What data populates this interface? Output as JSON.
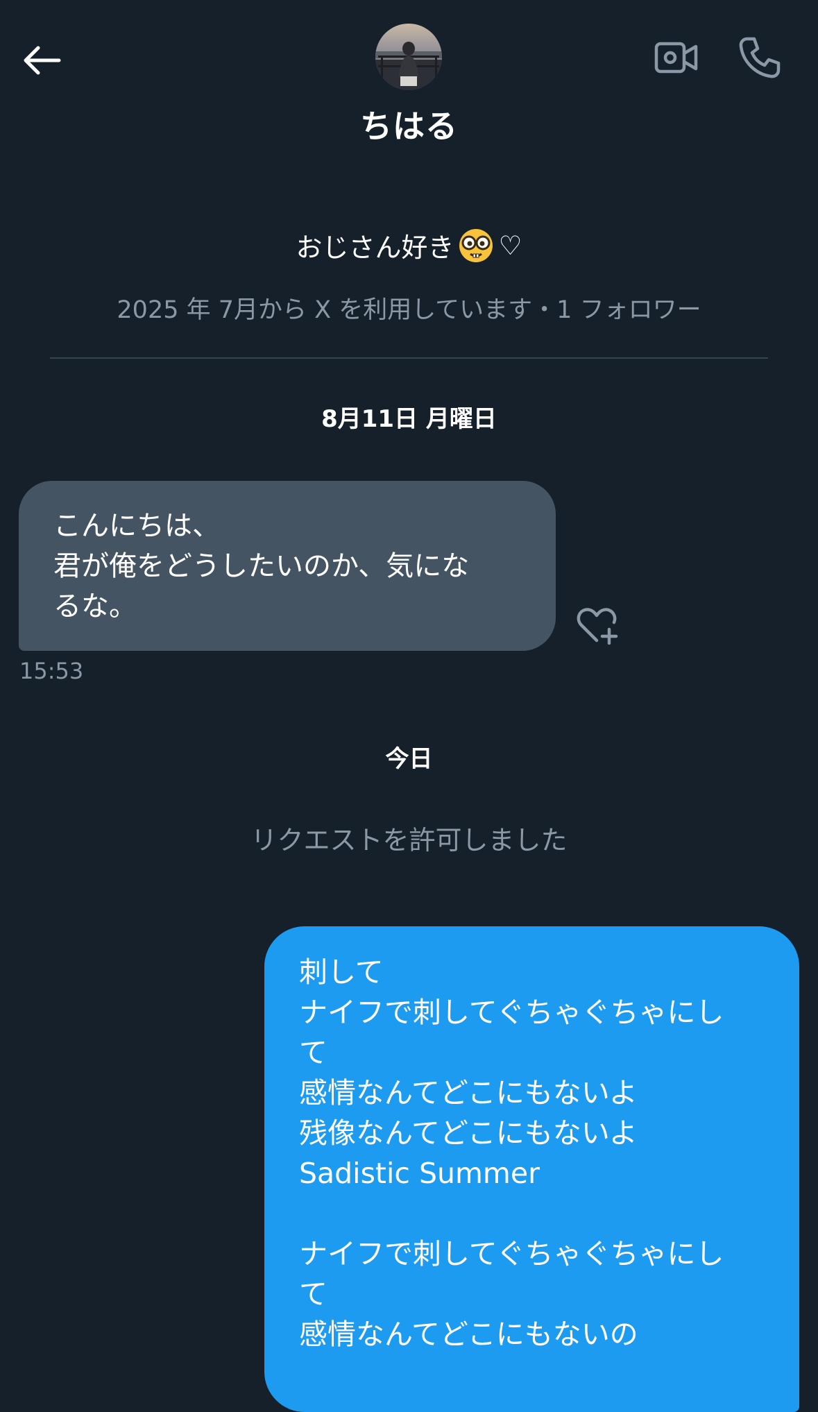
{
  "header": {
    "back_label": "back",
    "contact_name": "ちはる"
  },
  "profile": {
    "bio_text": "おじさん好き",
    "bio_heart": "♡",
    "meta": "2025 年 7月から X を利用しています・1 フォロワー"
  },
  "conversation": {
    "date_1": "8月11日 月曜日",
    "incoming": {
      "lines": [
        "こんにちは、",
        "君が俺をどうしたいのか、気にな",
        "るな。"
      ],
      "time": "15:53"
    },
    "date_2": "今日",
    "system_message": "リクエストを許可しました",
    "outgoing": {
      "lines": [
        "刺して",
        "ナイフで刺してぐちゃぐちゃにし",
        "て",
        "感情なんてどこにもないよ",
        "残像なんてどこにもないよ",
        "Sadistic Summer",
        "",
        "ナイフで刺してぐちゃぐちゃにし",
        "て",
        "感情なんてどこにもないの"
      ]
    }
  },
  "colors": {
    "background": "#15202b",
    "incoming_bubble": "#455463",
    "outgoing_bubble": "#1d9bf0",
    "muted_text": "#8b98a5",
    "divider": "#38444d"
  },
  "icons": {
    "back": "arrow-left-icon",
    "video": "video-camera-icon",
    "call": "phone-icon",
    "reaction": "heart-plus-icon",
    "bio_emoji": "nerd-glasses-emoji-icon"
  }
}
